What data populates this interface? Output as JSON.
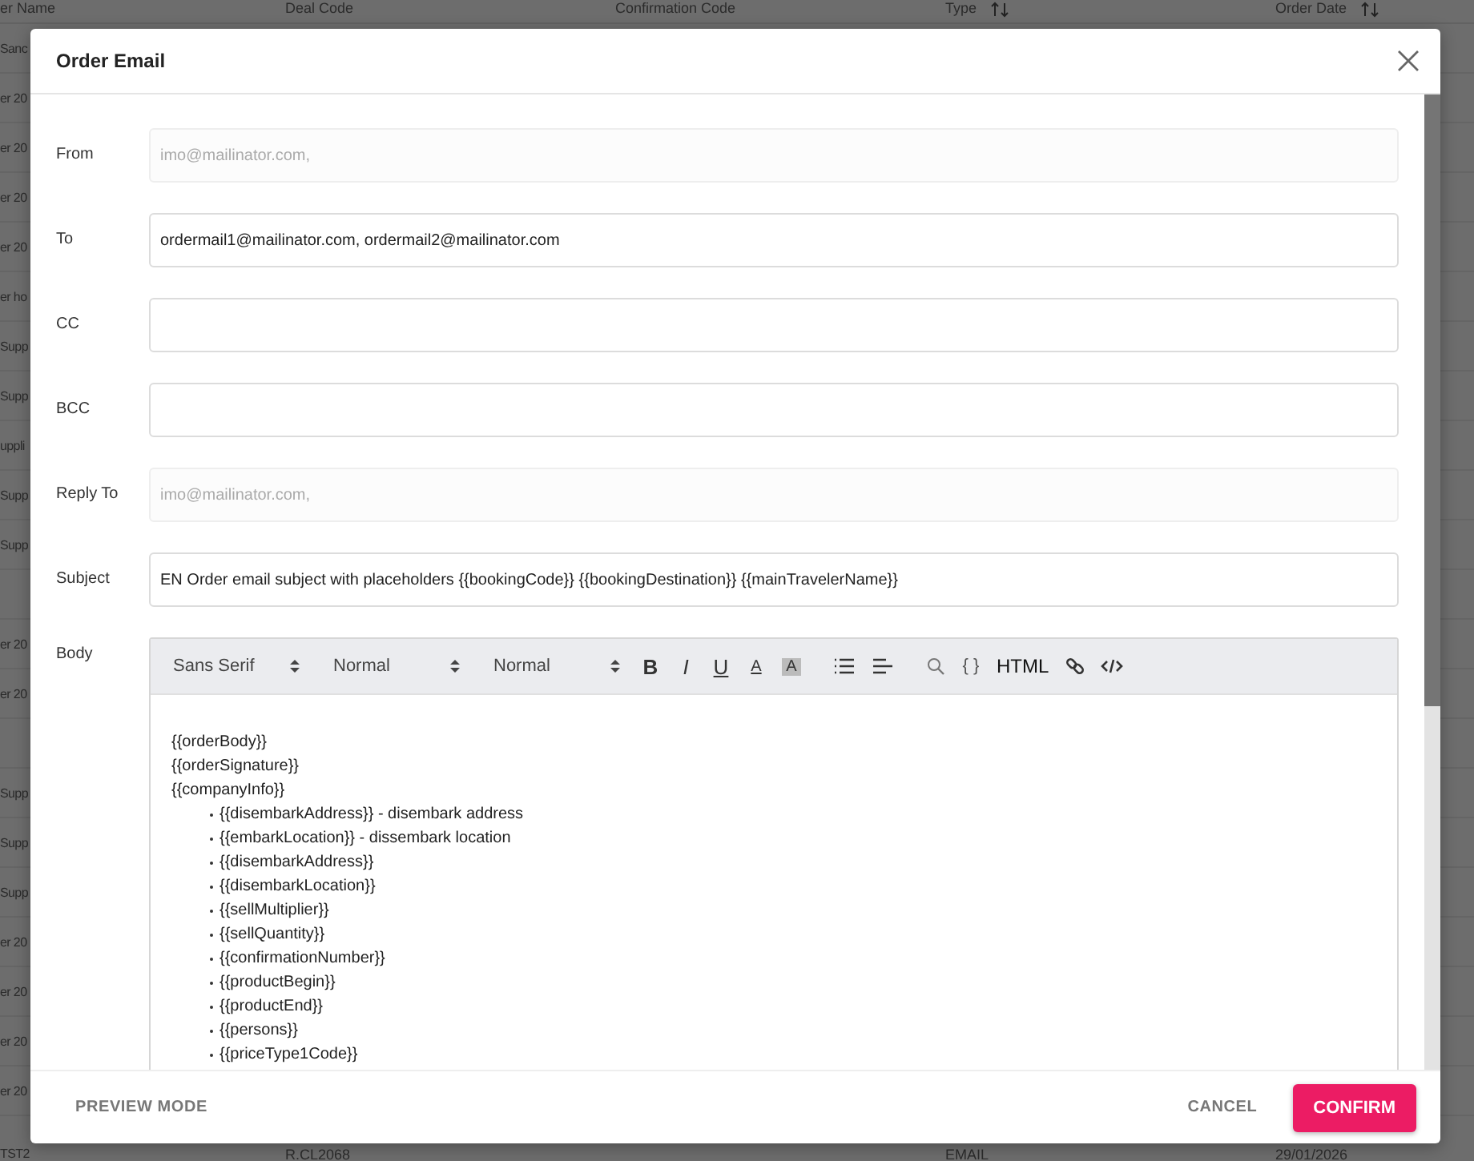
{
  "background_table": {
    "columns": [
      "er Name",
      "Deal Code",
      "Confirmation Code",
      "Type",
      "Order Date"
    ],
    "sortable": [
      false,
      false,
      false,
      true,
      true
    ],
    "rows": [
      {
        "kind": "text",
        "name": "Sanc"
      },
      {
        "kind": "text",
        "name": "er 20"
      },
      {
        "kind": "text",
        "name": "er 20"
      },
      {
        "kind": "text",
        "name": "er 20"
      },
      {
        "kind": "text",
        "name": "er 20"
      },
      {
        "kind": "text",
        "name": "er ho"
      },
      {
        "kind": "text",
        "name": "Supp"
      },
      {
        "kind": "text",
        "name": "Supp"
      },
      {
        "kind": "text",
        "name": "uppli"
      },
      {
        "kind": "text",
        "name": "Supp"
      },
      {
        "kind": "text",
        "name": "Supp"
      },
      {
        "kind": "blank"
      },
      {
        "kind": "text",
        "name": "er 20"
      },
      {
        "kind": "text",
        "name": "er 20"
      },
      {
        "kind": "blank"
      },
      {
        "kind": "text",
        "name": "Supp"
      },
      {
        "kind": "text",
        "name": "Supp"
      },
      {
        "kind": "text",
        "name": "Supp"
      },
      {
        "kind": "text",
        "name": "er 20"
      },
      {
        "kind": "text",
        "name": "er 20"
      },
      {
        "kind": "text",
        "name": "er 20"
      },
      {
        "kind": "text",
        "name": "er 20"
      }
    ],
    "last_row": {
      "name": "TST2",
      "deal_code": "R.CL2068",
      "type": "EMAIL",
      "order_date": "29/01/2026"
    }
  },
  "dialog": {
    "title": "Order Email",
    "fields": [
      {
        "label": "From",
        "placeholder": "imo@mailinator.com,",
        "disabled": true
      },
      {
        "label": "To",
        "value": "ordermail1@mailinator.com, ordermail2@mailinator.com",
        "disabled": false
      },
      {
        "label": "CC",
        "disabled": false
      },
      {
        "label": "BCC",
        "disabled": false
      },
      {
        "label": "Reply To",
        "placeholder": "imo@mailinator.com,",
        "disabled": true
      },
      {
        "label": "Subject",
        "value": "EN Order email subject with placeholders {{bookingCode}} {{bookingDestination}} {{mainTravelerName}}",
        "disabled": false
      }
    ],
    "body": {
      "label": "Body",
      "toolbar": [
        {
          "kind": "select",
          "label": "Sans Serif"
        },
        {
          "kind": "select",
          "label": "Normal"
        },
        {
          "kind": "select",
          "label": "Normal"
        },
        {
          "kind": "bold",
          "label": "B"
        },
        {
          "kind": "italic",
          "label": "I"
        },
        {
          "kind": "underline",
          "label": "U"
        },
        {
          "kind": "color",
          "label": "A"
        },
        {
          "kind": "background",
          "label": "A"
        },
        {
          "kind": "bullet-list"
        },
        {
          "kind": "align"
        },
        {
          "kind": "search"
        },
        {
          "kind": "braces",
          "label": "{ }"
        },
        {
          "kind": "html",
          "label": "HTML"
        },
        {
          "kind": "link"
        },
        {
          "kind": "code"
        }
      ],
      "lines": [
        "{{orderBody}}",
        "{{orderSignature}}",
        "{{companyInfo}}"
      ],
      "bullets": [
        "{{disembarkAddress}} - disembark address",
        "{{embarkLocation}} - dissembark location",
        "{{disembarkAddress}}",
        "{{disembarkLocation}}",
        "{{sellMultiplier}}",
        "{{sellQuantity}}",
        "{{confirmationNumber}}",
        "{{productBegin}}",
        "{{productEnd}}",
        "{{persons}}",
        "{{priceType1Code}}"
      ]
    },
    "footer": {
      "left": "PREVIEW MODE",
      "cancel": "CANCEL",
      "confirm": "CONFIRM"
    }
  }
}
